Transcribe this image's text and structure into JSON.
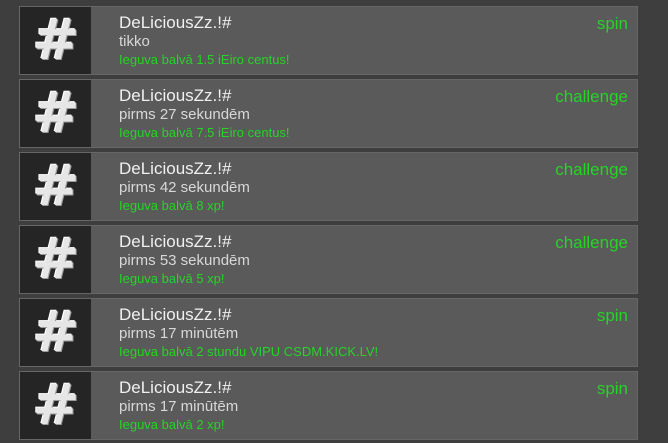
{
  "feed": {
    "items": [
      {
        "username": "DeLiciousZz.!#",
        "time": "tikko",
        "reward": "Ieguva balvā 1.5 iEiro centus!",
        "type": "spin",
        "avatar_icon": "hash-icon"
      },
      {
        "username": "DeLiciousZz.!#",
        "time": "pirms 27 sekundēm",
        "reward": "Ieguva balvā 7.5 iEiro centus!",
        "type": "challenge",
        "avatar_icon": "hash-icon"
      },
      {
        "username": "DeLiciousZz.!#",
        "time": "pirms 42 sekundēm",
        "reward": "Ieguva balvā 8 xp!",
        "type": "challenge",
        "avatar_icon": "hash-icon"
      },
      {
        "username": "DeLiciousZz.!#",
        "time": "pirms 53 sekundēm",
        "reward": "Ieguva balvā 5 xp!",
        "type": "challenge",
        "avatar_icon": "hash-icon"
      },
      {
        "username": "DeLiciousZz.!#",
        "time": "pirms 17 minūtēm",
        "reward": "Ieguva balvā 2 stundu VIPU CSDM.KICK.LV!",
        "type": "spin",
        "avatar_icon": "hash-icon"
      },
      {
        "username": "DeLiciousZz.!#",
        "time": "pirms 17 minūtēm",
        "reward": "Ieguva balvā 2 xp!",
        "type": "spin",
        "avatar_icon": "hash-icon"
      }
    ]
  },
  "colors": {
    "background": "#3e3e3e",
    "card": "#5a5a5a",
    "avatar_bg": "#252525",
    "accent_green": "#25d425",
    "text_primary": "#f0f0f0",
    "text_secondary": "#d8d8d8"
  }
}
